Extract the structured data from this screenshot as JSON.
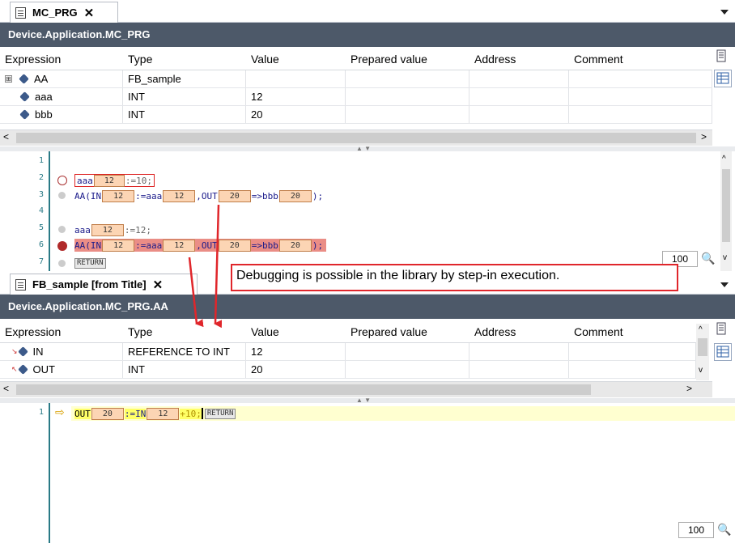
{
  "top_tab": {
    "label": "MC_PRG",
    "close": "✕"
  },
  "top_path": "Device.Application.MC_PRG",
  "watch_headers": [
    "Expression",
    "Type",
    "Value",
    "Prepared value",
    "Address",
    "Comment"
  ],
  "top_rows": [
    {
      "expr": "AA",
      "type": "FB_sample",
      "value": "",
      "expand": "⊞"
    },
    {
      "expr": "aaa",
      "type": "INT",
      "value": "12"
    },
    {
      "expr": "bbb",
      "type": "INT",
      "value": "20"
    }
  ],
  "top_code": {
    "line_numbers": [
      "1",
      "2",
      "3",
      "4",
      "5",
      "6",
      "7"
    ],
    "l2": {
      "var": "aaa",
      "mon": "12",
      "rest": ":=10;"
    },
    "l3": {
      "a": "AA(IN",
      "m1": "12",
      "b": ":=aaa",
      "m2": "12",
      "c": ",OUT",
      "m3": "20",
      "d": "=>bbb",
      "m4": "20",
      "e": ");"
    },
    "l5": {
      "var": "aaa",
      "mon": "12",
      "rest": ":=12;"
    },
    "l6": {
      "a": "AA(IN",
      "m1": "12",
      "b": ":=aaa",
      "m2": "12",
      "c": ",OUT",
      "m3": "20",
      "d": "=>bbb",
      "m4": "20",
      "e": ");"
    },
    "l7": "RETURN",
    "zoom": "100"
  },
  "bottom_tab": {
    "label": "FB_sample [from Title]",
    "close": "✕"
  },
  "callout": "Debugging is possible in the library by step-in execution.",
  "bottom_path": "Device.Application.MC_PRG.AA",
  "bottom_rows": [
    {
      "expr": "IN",
      "type": "REFERENCE TO INT",
      "value": "12"
    },
    {
      "expr": "OUT",
      "type": "INT",
      "value": "20"
    }
  ],
  "bottom_code": {
    "line_number": "1",
    "a": "OUT",
    "m1": "20",
    "b": ":=IN",
    "m2": "12",
    "c": "+10;",
    "ret": "RETURN",
    "zoom": "100"
  },
  "colors": {
    "pathbar": "#4d5969",
    "bp_active": "#b02a2a",
    "highlight_line": "#ea8d86",
    "current_line": "#ffffd0",
    "callout_border": "#e0262b"
  }
}
